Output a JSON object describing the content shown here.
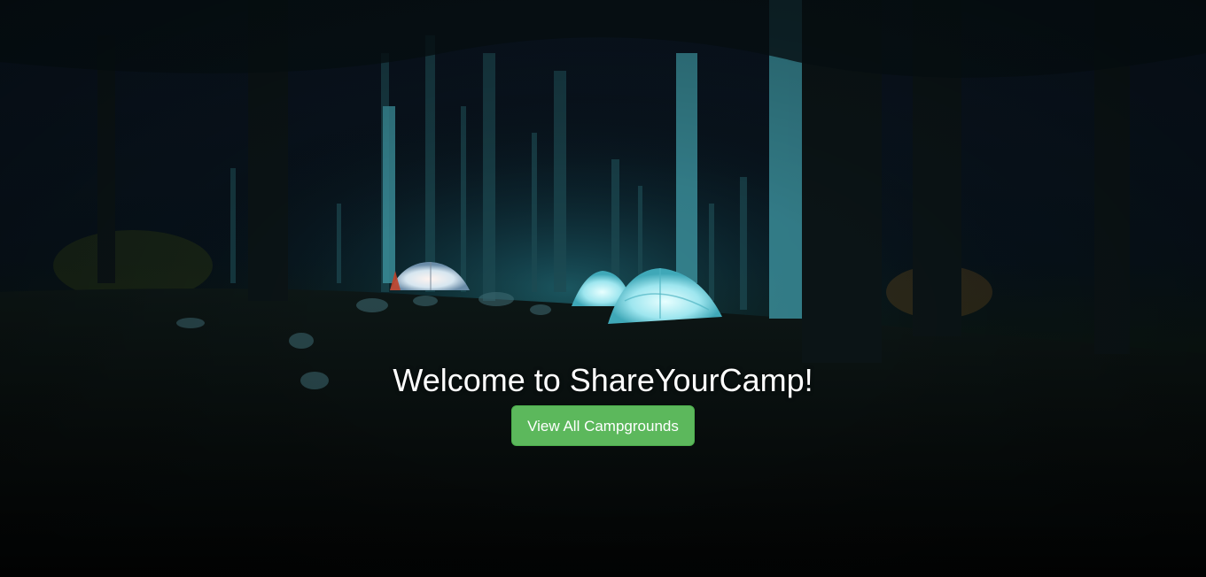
{
  "hero": {
    "title": "Welcome to ShareYourCamp!",
    "button_label": "View All Campgrounds",
    "background_image": "night-forest-campsite-with-glowing-tents"
  },
  "colors": {
    "button_bg": "#5cb85c",
    "button_border": "#4cae4c",
    "title_text": "#ffffff"
  }
}
